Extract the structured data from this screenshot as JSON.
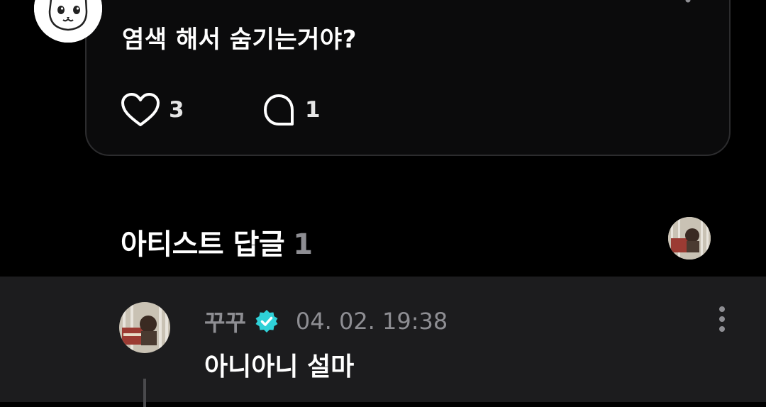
{
  "post": {
    "text": "염색 해서 숨기는거야?",
    "likes": "3",
    "comments": "1",
    "icons": {
      "like": "heart-icon",
      "comment": "speech-bubble-icon",
      "more": "more-vertical-icon"
    }
  },
  "artist_reply_section": {
    "title": "아티스트 답글",
    "count": "1"
  },
  "reply": {
    "name": "꾸꾸",
    "date": "04. 02. 19:38",
    "text": "아니아니 설마",
    "icons": {
      "verified": "verified-badge-icon",
      "more": "more-vertical-icon"
    }
  },
  "colors": {
    "background": "#000000",
    "card_border": "#2c2c2e",
    "reply_background": "#1c1c1e",
    "muted_text": "#8e8e93",
    "verified": "#2fd1d8"
  }
}
